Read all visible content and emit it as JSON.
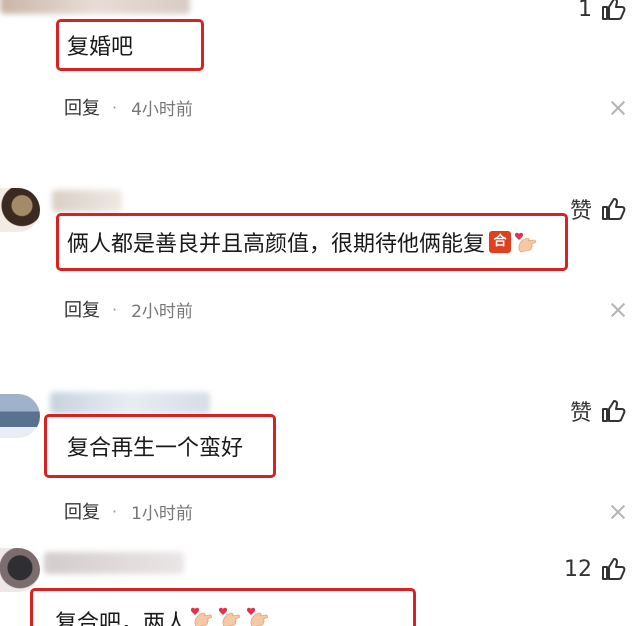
{
  "comments": [
    {
      "text": "复婚吧",
      "like_label": "1",
      "reply_label": "回复",
      "time": "4小时前"
    },
    {
      "text": "俩人都是善良并且高颜值，很期待他俩能复",
      "badge": "合",
      "like_label": "赞",
      "reply_label": "回复",
      "time": "2小时前"
    },
    {
      "text": "复合再生一个蛮好",
      "like_label": "赞",
      "reply_label": "回复",
      "time": "1小时前"
    },
    {
      "text": "复合吧，两人",
      "like_label": "12"
    }
  ],
  "separator": "·",
  "icons": {
    "like": "thumbs-up-icon",
    "close": "close-icon",
    "heart_hand": "heart-hand-emoji-icon"
  },
  "colors": {
    "highlight_border": "#d92121",
    "badge": "#e0401f"
  }
}
